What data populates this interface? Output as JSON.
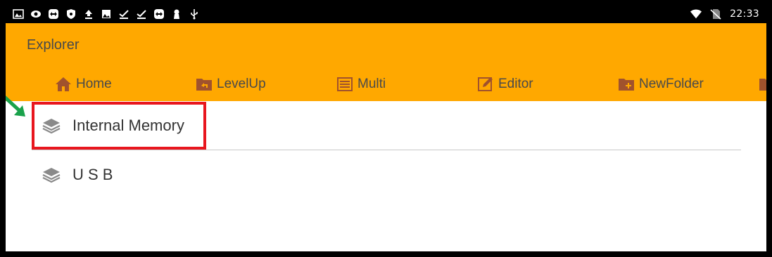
{
  "status_bar": {
    "time": "22:33",
    "icons": [
      "gallery-icon",
      "eye-icon",
      "teamviewer-icon",
      "shield-icon",
      "upload-icon",
      "image-icon",
      "check-icon",
      "check-icon",
      "teamviewer-icon",
      "keyhole-icon",
      "usb-icon"
    ],
    "right_icons": [
      "wifi-icon",
      "no-sim-icon"
    ]
  },
  "app": {
    "title": "Explorer",
    "toolbar": [
      {
        "label": "Home",
        "icon": "home-icon"
      },
      {
        "label": "LevelUp",
        "icon": "folder-up-icon"
      },
      {
        "label": "Multi",
        "icon": "multi-select-icon"
      },
      {
        "label": "Editor",
        "icon": "edit-icon"
      },
      {
        "label": "NewFolder",
        "icon": "new-folder-icon"
      }
    ]
  },
  "storage_list": [
    {
      "label": "Internal Memory",
      "icon": "storage-stack-icon"
    },
    {
      "label": "U S B",
      "icon": "storage-stack-icon"
    }
  ],
  "colors": {
    "appbar": "#FFA800",
    "highlight": "#E8161E",
    "arrow": "#1AA24B"
  }
}
